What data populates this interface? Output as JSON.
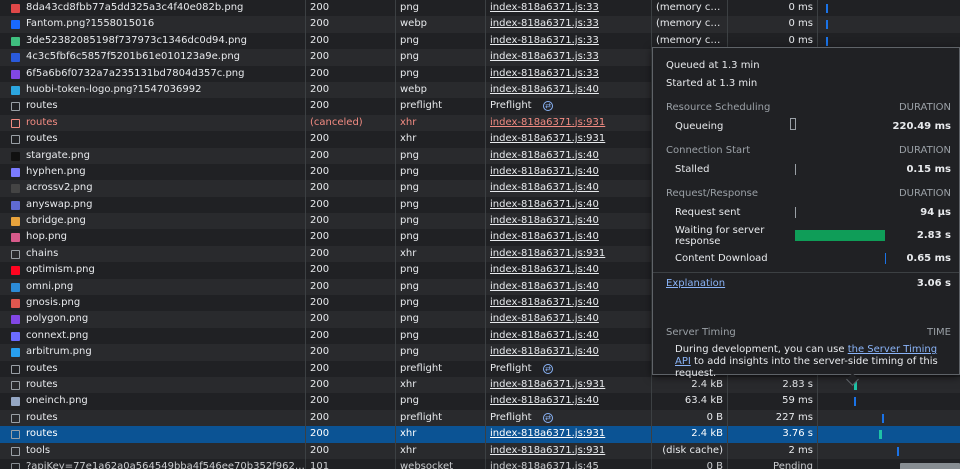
{
  "requests": [
    {
      "name": "8da43cd8fbb77a5dd325a3c4f40e082b.png",
      "status": "200",
      "type": "png",
      "initiator": "index-818a6371.js:33",
      "size": "(memory cache)",
      "time": "0 ms",
      "icon_color": "#e04848",
      "wf": "blue-early"
    },
    {
      "name": "Fantom.png?1558015016",
      "status": "200",
      "type": "webp",
      "initiator": "index-818a6371.js:33",
      "size": "(memory cache)",
      "time": "0 ms",
      "icon_color": "#1969ff",
      "wf": "blue-early"
    },
    {
      "name": "3de52382085198f737973c1346dc0d94.png",
      "status": "200",
      "type": "png",
      "initiator": "index-818a6371.js:33",
      "size": "(memory cache)",
      "time": "0 ms",
      "icon_color": "#3fbf7f",
      "wf": "blue-early"
    },
    {
      "name": "4c3c5fbf6c5857f5201b61e010123a9e.png",
      "status": "200",
      "type": "png",
      "initiator": "index-818a6371.js:33",
      "size": "",
      "time": "",
      "icon_color": "#2a5ada",
      "wf": ""
    },
    {
      "name": "6f5a6b6f0732a7a235131bd7804d357c.png",
      "status": "200",
      "type": "png",
      "initiator": "index-818a6371.js:33",
      "size": "",
      "time": "",
      "icon_color": "#8247e5",
      "wf": ""
    },
    {
      "name": "huobi-token-logo.png?1547036992",
      "status": "200",
      "type": "webp",
      "initiator": "index-818a6371.js:40",
      "size": "",
      "time": "",
      "icon_color": "#2ca6e0",
      "wf": ""
    },
    {
      "name": "routes",
      "status": "200",
      "type": "preflight",
      "initiator": "Preflight",
      "preflight": true,
      "size": "",
      "time": "",
      "icon_color": "",
      "wf": ""
    },
    {
      "name": "routes",
      "status": "(canceled)",
      "type": "xhr",
      "initiator": "index-818a6371.js:931",
      "error": true,
      "size": "",
      "time": "",
      "icon_color": "",
      "wf": ""
    },
    {
      "name": "routes",
      "status": "200",
      "type": "xhr",
      "initiator": "index-818a6371.js:931",
      "size": "",
      "time": "",
      "icon_color": "",
      "wf": ""
    },
    {
      "name": "stargate.png",
      "status": "200",
      "type": "png",
      "initiator": "index-818a6371.js:40",
      "size": "",
      "time": "",
      "icon_color": "#111111",
      "wf": ""
    },
    {
      "name": "hyphen.png",
      "status": "200",
      "type": "png",
      "initiator": "index-818a6371.js:40",
      "size": "",
      "time": "",
      "icon_color": "#7b7bff",
      "wf": ""
    },
    {
      "name": "acrossv2.png",
      "status": "200",
      "type": "png",
      "initiator": "index-818a6371.js:40",
      "size": "",
      "time": "",
      "icon_color": "#444444",
      "wf": ""
    },
    {
      "name": "anyswap.png",
      "status": "200",
      "type": "png",
      "initiator": "index-818a6371.js:40",
      "size": "",
      "time": "",
      "icon_color": "#5f6ad3",
      "wf": ""
    },
    {
      "name": "cbridge.png",
      "status": "200",
      "type": "png",
      "initiator": "index-818a6371.js:40",
      "size": "",
      "time": "",
      "icon_color": "#e8a33c",
      "wf": ""
    },
    {
      "name": "hop.png",
      "status": "200",
      "type": "png",
      "initiator": "index-818a6371.js:40",
      "size": "",
      "time": "",
      "icon_color": "#d75a8a",
      "wf": ""
    },
    {
      "name": "chains",
      "status": "200",
      "type": "xhr",
      "initiator": "index-818a6371.js:931",
      "size": "",
      "time": "",
      "icon_color": "",
      "wf": ""
    },
    {
      "name": "optimism.png",
      "status": "200",
      "type": "png",
      "initiator": "index-818a6371.js:40",
      "size": "",
      "time": "",
      "icon_color": "#ff0420",
      "wf": ""
    },
    {
      "name": "omni.png",
      "status": "200",
      "type": "png",
      "initiator": "index-818a6371.js:40",
      "size": "",
      "time": "",
      "icon_color": "#2c8bd6",
      "wf": ""
    },
    {
      "name": "gnosis.png",
      "status": "200",
      "type": "png",
      "initiator": "index-818a6371.js:40",
      "size": "",
      "time": "",
      "icon_color": "#e0574f",
      "wf": ""
    },
    {
      "name": "polygon.png",
      "status": "200",
      "type": "png",
      "initiator": "index-818a6371.js:40",
      "size": "",
      "time": "",
      "icon_color": "#8247e5",
      "wf": ""
    },
    {
      "name": "connext.png",
      "status": "200",
      "type": "png",
      "initiator": "index-818a6371.js:40",
      "size": "",
      "time": "",
      "icon_color": "#6b6bff",
      "wf": ""
    },
    {
      "name": "arbitrum.png",
      "status": "200",
      "type": "png",
      "initiator": "index-818a6371.js:40",
      "size": "",
      "time": "",
      "icon_color": "#28a0f0",
      "wf": ""
    },
    {
      "name": "routes",
      "status": "200",
      "type": "preflight",
      "initiator": "Preflight",
      "preflight": true,
      "size": "",
      "time": "",
      "icon_color": "",
      "wf": ""
    },
    {
      "name": "routes",
      "status": "200",
      "type": "xhr",
      "initiator": "index-818a6371.js:931",
      "size": "2.4 kB",
      "time": "2.83 s",
      "icon_color": "",
      "wf": "teal-mid"
    },
    {
      "name": "oneinch.png",
      "status": "200",
      "type": "png",
      "initiator": "index-818a6371.js:40",
      "size": "63.4 kB",
      "time": "59 ms",
      "icon_color": "#94a6c3",
      "wf": "blue-mid"
    },
    {
      "name": "routes",
      "status": "200",
      "type": "preflight",
      "initiator": "Preflight",
      "preflight": true,
      "size": "0 B",
      "time": "227 ms",
      "icon_color": "",
      "wf": "blue-late"
    },
    {
      "name": "routes",
      "status": "200",
      "type": "xhr",
      "initiator": "index-818a6371.js:931",
      "size": "2.4 kB",
      "time": "3.76 s",
      "selected": true,
      "icon_color": "",
      "wf": "teal-late"
    },
    {
      "name": "tools",
      "status": "200",
      "type": "xhr",
      "initiator": "index-818a6371.js:931",
      "size": "(disk cache)",
      "time": "2 ms",
      "icon_color": "",
      "wf": "blue-end"
    },
    {
      "name": "?apiKey=77e1a62a0a564549bba4f546ee70b352f962f11a28...",
      "status": "101",
      "type": "websocket",
      "initiator": "index-818a6371.js:45",
      "size": "0 B",
      "time": "Pending",
      "icon_color": "",
      "wf": "knob",
      "cut": true
    }
  ],
  "timing": {
    "queued_at": "Queued at 1.3 min",
    "started_at": "Started at 1.3 min",
    "duration_header": "DURATION",
    "resource_scheduling": {
      "title": "Resource Scheduling",
      "queueing_label": "Queueing",
      "queueing_value": "220.49 ms"
    },
    "connection_start": {
      "title": "Connection Start",
      "stalled_label": "Stalled",
      "stalled_value": "0.15 ms"
    },
    "request_response": {
      "title": "Request/Response",
      "sent_label": "Request sent",
      "sent_value": "94 µs",
      "waiting_label": "Waiting for server response",
      "waiting_value": "2.83 s",
      "download_label": "Content Download",
      "download_value": "0.65 ms"
    },
    "explanation_link": "Explanation",
    "total_value": "3.06 s",
    "server_timing": {
      "title": "Server Timing",
      "time_header": "TIME",
      "desc_before": "During development, you can use ",
      "desc_link": "the Server Timing API",
      "desc_after": " to add insights into the server-side timing of this request."
    },
    "colors": {
      "waiting": "#0f9d58",
      "download": "#1a73e8"
    }
  }
}
